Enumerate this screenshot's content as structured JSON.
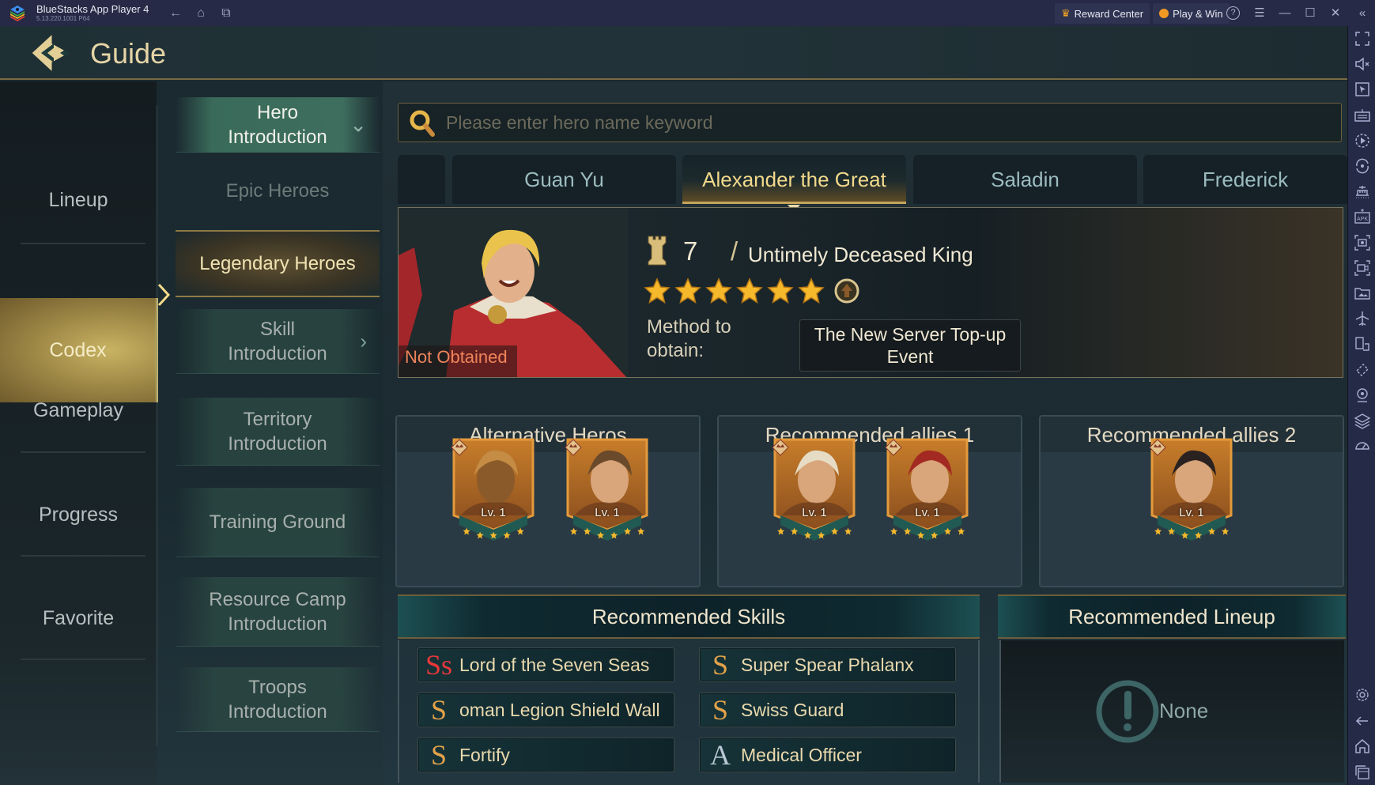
{
  "titlebar": {
    "app_name": "BlueStacks App Player 4",
    "version": "5.13.220.1001  P64",
    "reward_center": "Reward Center",
    "play_win": "Play & Win",
    "icons": [
      "back-icon",
      "home-icon",
      "recent-apps-icon",
      "help-icon",
      "menu-icon",
      "minimize-icon",
      "maximize-icon",
      "close-icon",
      "collapse-sidebar-icon"
    ]
  },
  "header": {
    "title": "Guide"
  },
  "left_nav": {
    "items": [
      {
        "label": "Lineup",
        "active": false
      },
      {
        "label": "Codex",
        "active": true
      },
      {
        "label": "Gameplay",
        "active": false
      },
      {
        "label": "Progress",
        "active": false
      },
      {
        "label": "Favorite",
        "active": false
      }
    ]
  },
  "sub_nav": {
    "items": [
      {
        "label": "Hero Introduction",
        "state": "expanded"
      },
      {
        "label": "Epic Heroes",
        "state": "child"
      },
      {
        "label": "Legendary Heroes",
        "state": "selected"
      },
      {
        "label": "Skill Introduction",
        "state": "collapsed"
      },
      {
        "label": "Territory Introduction",
        "state": "normal"
      },
      {
        "label": "Training Ground",
        "state": "normal"
      },
      {
        "label": "Resource Camp Introduction",
        "state": "normal"
      },
      {
        "label": "Troops Introduction",
        "state": "normal"
      }
    ]
  },
  "search": {
    "placeholder": "Please enter hero name keyword",
    "value": ""
  },
  "hero_tabs": [
    {
      "label": "",
      "active": false
    },
    {
      "label": "Guan Yu",
      "active": false
    },
    {
      "label": "Alexander the Great",
      "active": true
    },
    {
      "label": "Saladin",
      "active": false
    },
    {
      "label": "Frederick",
      "active": false
    }
  ],
  "hero": {
    "status": "Not Obtained",
    "rank": "7",
    "separator": "/",
    "title": "Untimely Deceased King",
    "stars": 6,
    "method_label": "Method to obtain:",
    "method_value": "The New Server Top-up Event"
  },
  "cards": [
    {
      "title": "Alternative Heros",
      "heroes": [
        {
          "level": "Lv. 1",
          "stars": 5
        },
        {
          "level": "Lv. 1",
          "stars": 6
        }
      ]
    },
    {
      "title": "Recommended allies 1",
      "heroes": [
        {
          "level": "Lv. 1",
          "stars": 6
        },
        {
          "level": "Lv. 1",
          "stars": 6
        }
      ]
    },
    {
      "title": "Recommended allies 2",
      "heroes": [
        {
          "level": "Lv. 1",
          "stars": 6
        }
      ]
    }
  ],
  "skills": {
    "title": "Recommended Skills",
    "items": [
      {
        "grade": "Ss",
        "name": "Lord of the Seven Seas",
        "color": "#e8383a"
      },
      {
        "grade": "S",
        "name": "Super Spear Phalanx",
        "color": "#e2a24a"
      },
      {
        "grade": "S",
        "name": "oman Legion Shield Wall",
        "color": "#e2a24a"
      },
      {
        "grade": "S",
        "name": "Swiss Guard",
        "color": "#e2a24a"
      },
      {
        "grade": "S",
        "name": "Fortify",
        "color": "#e2a24a"
      },
      {
        "grade": "A",
        "name": "Medical Officer",
        "color": "#b9c9d6"
      }
    ]
  },
  "lineup": {
    "title": "Recommended Lineup",
    "empty_text": "None"
  },
  "right_sidebar": {
    "icons": [
      "fullscreen-icon",
      "volume-mute-icon",
      "pointer-icon",
      "keyboard-icon",
      "macro-record-icon",
      "rotate-icon",
      "shake-icon",
      "apk-install-icon",
      "screenshot-icon",
      "screen-record-icon",
      "media-folder-icon",
      "airplane-mode-icon",
      "multi-instance-icon",
      "eco-mode-icon",
      "location-icon",
      "layers-icon",
      "performance-icon",
      "settings-icon",
      "back-icon",
      "home-icon",
      "recent-apps-icon"
    ]
  },
  "colors": {
    "accent_gold": "#f3d98a",
    "not_obtained": "#f0845a",
    "titlebar": "#262a46"
  }
}
